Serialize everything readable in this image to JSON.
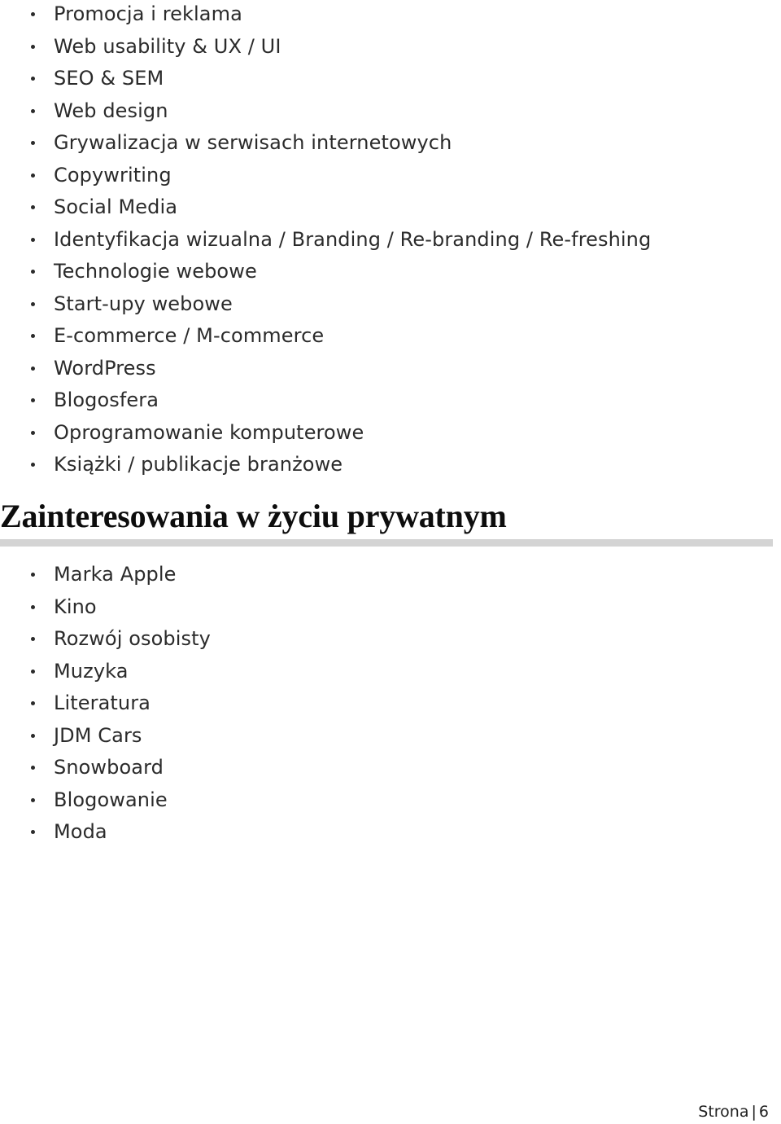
{
  "document": {
    "type": "cv-page",
    "background_color": "#ffffff",
    "text_color": "#2b2b2b",
    "heading_color": "#0d0d0d",
    "rule_color": "#d4d4d4"
  },
  "professional_interests": {
    "items": [
      "Promocja i reklama",
      "Web usability & UX / UI",
      "SEO & SEM",
      "Web design",
      "Grywalizacja w serwisach internetowych",
      "Copywriting",
      "Social Media",
      "Identyfikacja wizualna / Branding / Re-branding / Re-freshing",
      "Technologie webowe",
      "Start-upy webowe",
      "E-commerce / M-commerce",
      "WordPress",
      "Blogosfera",
      "Oprogramowanie komputerowe",
      "Książki / publikacje branżowe"
    ]
  },
  "private_interests": {
    "heading": "Zainteresowania w życiu prywatnym",
    "items": [
      "Marka Apple",
      "Kino",
      "Rozwój osobisty",
      "Muzyka",
      "Literatura",
      "JDM Cars",
      "Snowboard",
      "Blogowanie",
      "Moda"
    ]
  },
  "footer": {
    "label": "Strona",
    "separator": "|",
    "page_number": "6"
  }
}
